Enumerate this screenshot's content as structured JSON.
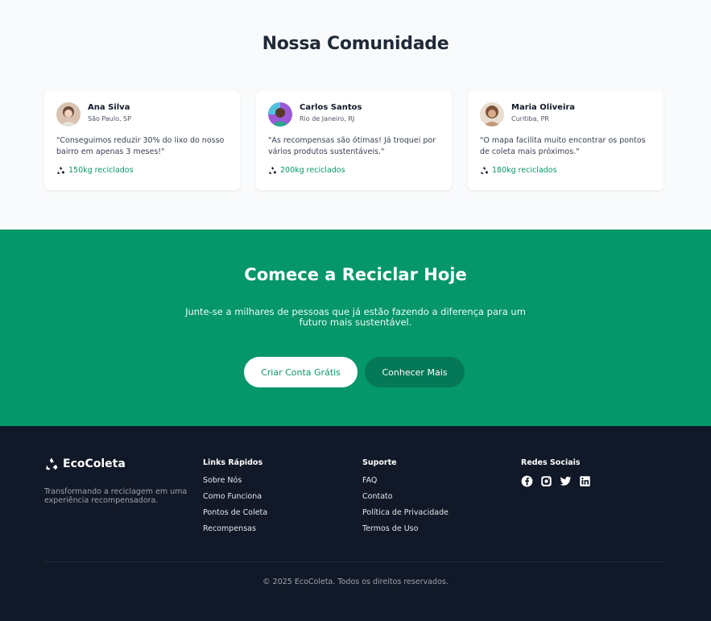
{
  "community": {
    "title": "Nossa Comunidade",
    "testimonials": [
      {
        "name": "Ana Silva",
        "location": "São Paulo, SP",
        "quote": "\"Conseguimos reduzir 30% do lixo do nosso bairro em apenas 3 meses!\"",
        "stat": "150kg reciclados"
      },
      {
        "name": "Carlos Santos",
        "location": "Rio de Janeiro, RJ",
        "quote": "\"As recompensas são ótimas! Já troquei por vários produtos sustentáveis.\"",
        "stat": "200kg reciclados"
      },
      {
        "name": "Maria Oliveira",
        "location": "Curitiba, PR",
        "quote": "\"O mapa facilita muito encontrar os pontos de coleta mais próximos.\"",
        "stat": "180kg reciclados"
      }
    ]
  },
  "cta": {
    "title": "Comece a Reciclar Hoje",
    "subtitle": "Junte-se a milhares de pessoas que já estão fazendo a diferença para um futuro mais sustentável.",
    "primary_label": "Criar Conta Grátis",
    "secondary_label": "Conhecer Mais"
  },
  "footer": {
    "brand": "EcoColeta",
    "tagline": "Transformando a reciclagem em uma experiência recompensadora.",
    "quick_links": {
      "title": "Links Rápidos",
      "items": [
        "Sobre Nós",
        "Como Funciona",
        "Pontos de Coleta",
        "Recompensas"
      ]
    },
    "support": {
      "title": "Suporte",
      "items": [
        "FAQ",
        "Contato",
        "Política de Privacidade",
        "Termos de Uso"
      ]
    },
    "social": {
      "title": "Redes Sociais",
      "icons": [
        "facebook-icon",
        "instagram-icon",
        "twitter-icon",
        "linkedin-icon"
      ]
    },
    "copyright": "© 2025 EcoColeta. Todos os direitos reservados."
  },
  "colors": {
    "primary": "#059669",
    "primary_dark": "#047857",
    "footer_bg": "#111827",
    "page_bg": "#f9fafb"
  }
}
